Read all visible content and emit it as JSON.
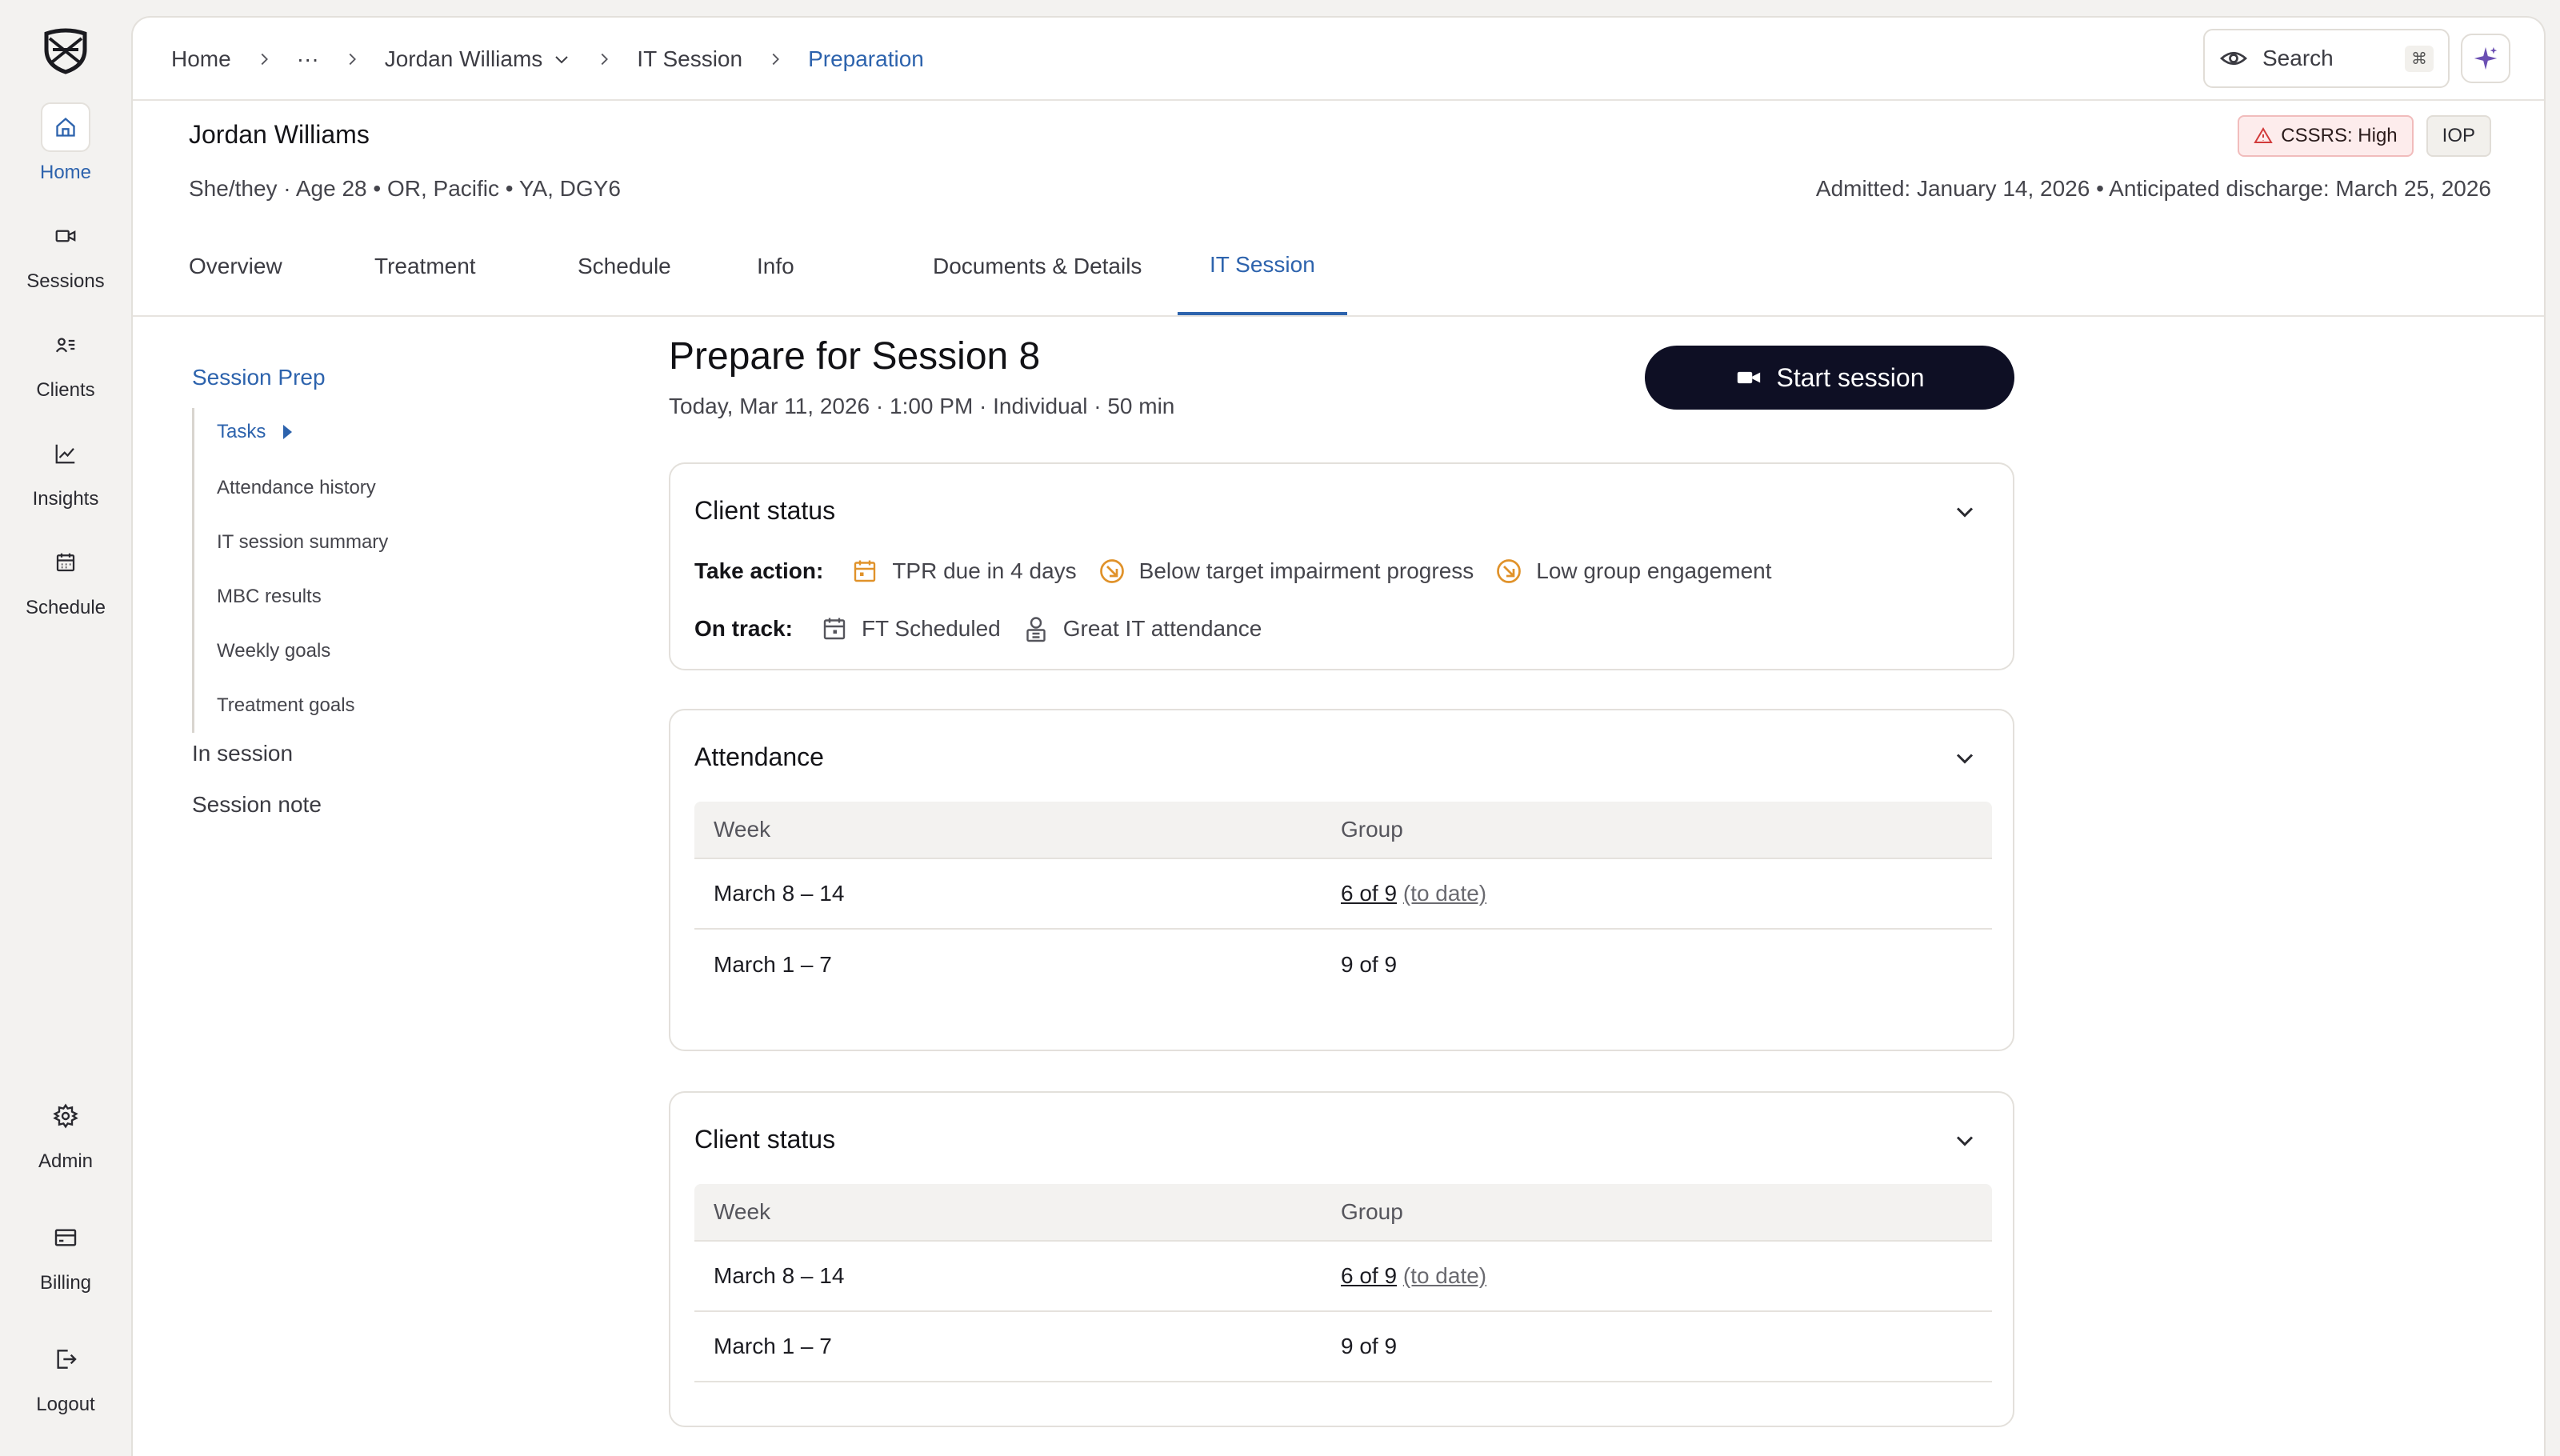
{
  "nav": {
    "items": [
      {
        "label": "Home",
        "icon": "home-icon"
      },
      {
        "label": "Sessions",
        "icon": "video-icon"
      },
      {
        "label": "Clients",
        "icon": "clients-icon"
      },
      {
        "label": "Insights",
        "icon": "chart-icon"
      },
      {
        "label": "Schedule",
        "icon": "calendar-icon"
      }
    ],
    "bottom": [
      {
        "label": "Admin",
        "icon": "gear-icon"
      },
      {
        "label": "Billing",
        "icon": "billing-icon"
      },
      {
        "label": "Logout",
        "icon": "logout-icon"
      }
    ],
    "active": "Home"
  },
  "breadcrumb": {
    "home": "Home",
    "ellipsis": "···",
    "client": "Jordan Williams",
    "session": "IT Session",
    "current": "Preparation"
  },
  "search": {
    "placeholder": "Search",
    "shortcut": "⌘"
  },
  "client": {
    "name": "Jordan Williams",
    "meta": "She/they · Age 28 • OR, Pacific • YA, DGY6",
    "risk_badge": "CSSRS: High",
    "program_badge": "IOP",
    "admission": "Admitted: January 14, 2026 • Anticipated discharge: March 25, 2026"
  },
  "tabs": [
    {
      "label": "Overview"
    },
    {
      "label": "Treatment"
    },
    {
      "label": "Schedule"
    },
    {
      "label": "Info"
    },
    {
      "label": "Documents & Details"
    },
    {
      "label": "IT Session"
    }
  ],
  "subnav": {
    "title": "Session Prep",
    "items": [
      "Tasks",
      "Attendance history",
      "IT session summary",
      "MBC results",
      "Weekly goals",
      "Treatment goals"
    ],
    "sections": [
      "In session",
      "Session note"
    ]
  },
  "session": {
    "title": "Prepare for Session 8",
    "subtitle": "Today, Mar 11, 2026 · 1:00 PM · Individual · 50 min",
    "start_label": "Start session"
  },
  "client_status": {
    "title": "Client status",
    "take_action_label": "Take action:",
    "take_action": [
      {
        "label": "TPR due in 4 days",
        "icon": "calendar-icon"
      },
      {
        "label": "Below target impairment progress",
        "icon": "trend-down-icon"
      },
      {
        "label": "Low group engagement",
        "icon": "trend-down-icon"
      }
    ],
    "on_track_label": "On track:",
    "on_track": [
      {
        "label": "FT Scheduled",
        "icon": "calendar-icon"
      },
      {
        "label": "Great IT attendance",
        "icon": "person-icon"
      }
    ]
  },
  "attendance": {
    "title": "Attendance",
    "headers": [
      "Week",
      "Group"
    ],
    "rows": [
      {
        "week": "March 8 – 14",
        "group": "6 of 9",
        "note": "(to date)"
      },
      {
        "week": "March 1 – 7",
        "group": "9 of 9",
        "note": ""
      }
    ]
  },
  "client_status_2": {
    "title": "Client status",
    "headers": [
      "Week",
      "Group"
    ],
    "rows": [
      {
        "week": "March 8 – 14",
        "group": "6 of 9",
        "note": "(to date)"
      },
      {
        "week": "March 1 – 7",
        "group": "9 of 9",
        "note": ""
      }
    ]
  },
  "colors": {
    "accent": "#2d63ad",
    "primary_button": "#0e0f24",
    "warning": "#e0922a",
    "danger": "#d23b3b",
    "ai": "#6b4fb3"
  }
}
